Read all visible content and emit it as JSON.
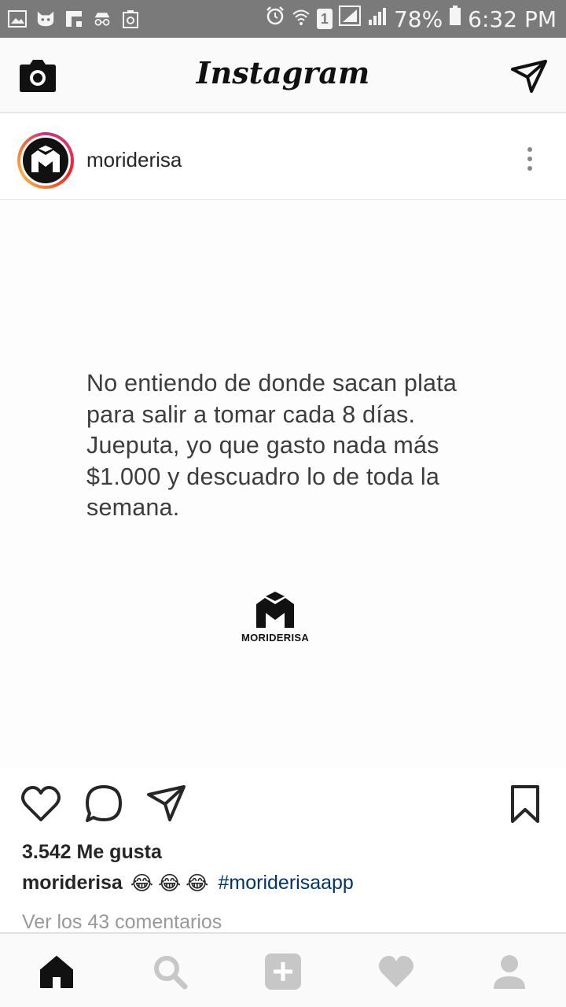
{
  "status_bar": {
    "battery_percent": "78%",
    "time": "6:32 PM",
    "sim_badge": "1",
    "left_icons": [
      "gallery-icon",
      "cat-face-icon",
      "flipboard-icon",
      "incognito-icon",
      "recycle-icon"
    ],
    "right_icons": [
      "alarm-icon",
      "wifi-icon",
      "sim-icon",
      "signal-icon",
      "signal-bars-icon",
      "battery-icon"
    ]
  },
  "header": {
    "title": "Instagram",
    "left_icon": "camera-icon",
    "right_icon": "direct-send-icon"
  },
  "post": {
    "username": "moriderisa",
    "image_text": "No entiendo de donde sacan plata para salir a tomar cada 8 días. Jueputa, yo que gasto nada más $1.000 y descuadro lo de toda la semana.",
    "image_brand": "MORIDERISA",
    "likes": "3.542 Me gusta",
    "caption_user": "moriderisa",
    "caption_emojis": [
      "😂",
      "😂",
      "😂"
    ],
    "caption_hashtag": "#moriderisaapp",
    "view_comments": "Ver los 43 comentarios"
  },
  "bottom_nav": [
    "home-icon",
    "search-icon",
    "add-post-icon",
    "activity-heart-icon",
    "profile-icon"
  ],
  "colors": {
    "status_bar_bg": "#7a7a7a",
    "hashtag": "#003569",
    "muted_text": "#999999",
    "nav_inactive": "#c7c7c7"
  }
}
